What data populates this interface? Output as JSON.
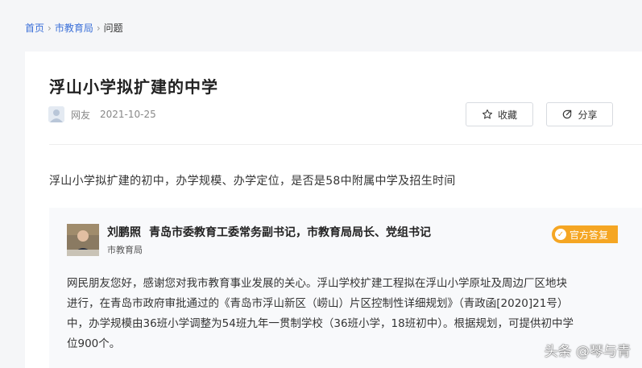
{
  "breadcrumb": {
    "home": "首页",
    "department": "市教育局",
    "current": "问题"
  },
  "question": {
    "title": "浮山小学拟扩建的中学",
    "author": "网友",
    "date": "2021-10-25",
    "body": "浮山小学拟扩建的初中，办学规模、办学定位，是否是58中附属中学及招生时间"
  },
  "actions": {
    "favorite_label": "收藏",
    "share_label": "分享"
  },
  "answer": {
    "name": "刘鹏照",
    "title": "青岛市委教育工委常务副书记，市教育局局长、党组书记",
    "org": "市教育局",
    "badge": "官方答复",
    "lines": [
      "网民朋友您好，感谢您对我市教育事业发展的关心。浮山学校扩建工程拟在浮山小学原址及周边厂区地块",
      "进行，在青岛市政府审批通过的《青岛市浮山新区（崂山）片区控制性详细规划》（青政函[2020]21号）",
      "中，办学规模由36班小学调整为54班九年一贯制学校（36班小学，18班初中）。根据规划，可提供初中学",
      "位900个。"
    ]
  },
  "watermark": "头条 @琴与青",
  "colors": {
    "link": "#3a6fd8",
    "badge": "#f5a623"
  }
}
